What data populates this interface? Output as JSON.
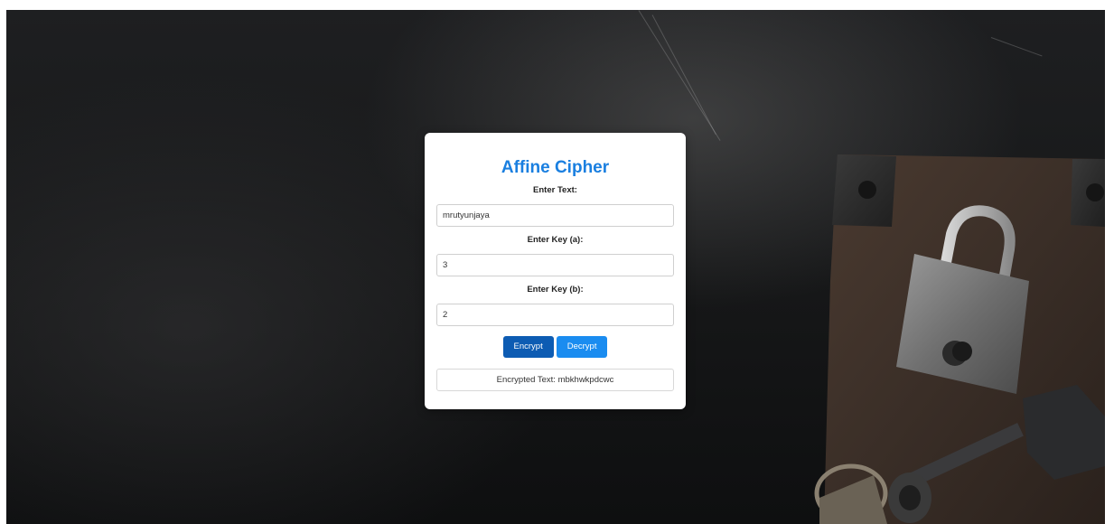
{
  "app": {
    "title": "Affine Cipher"
  },
  "form": {
    "text_label": "Enter Text:",
    "text_value": "mrutyunjaya",
    "key_a_label": "Enter Key (a):",
    "key_a_value": "3",
    "key_b_label": "Enter Key (b):",
    "key_b_value": "2"
  },
  "actions": {
    "encrypt_label": "Encrypt",
    "decrypt_label": "Decrypt"
  },
  "result": {
    "text": "Encrypted Text: mbkhwkpdcwc"
  },
  "colors": {
    "title": "#1a7fe0",
    "encrypt_button": "#0d5cb3",
    "decrypt_button": "#1a8cf0",
    "background": "#18191a"
  },
  "background": {
    "image_icon": "padlock-and-keys-image"
  }
}
